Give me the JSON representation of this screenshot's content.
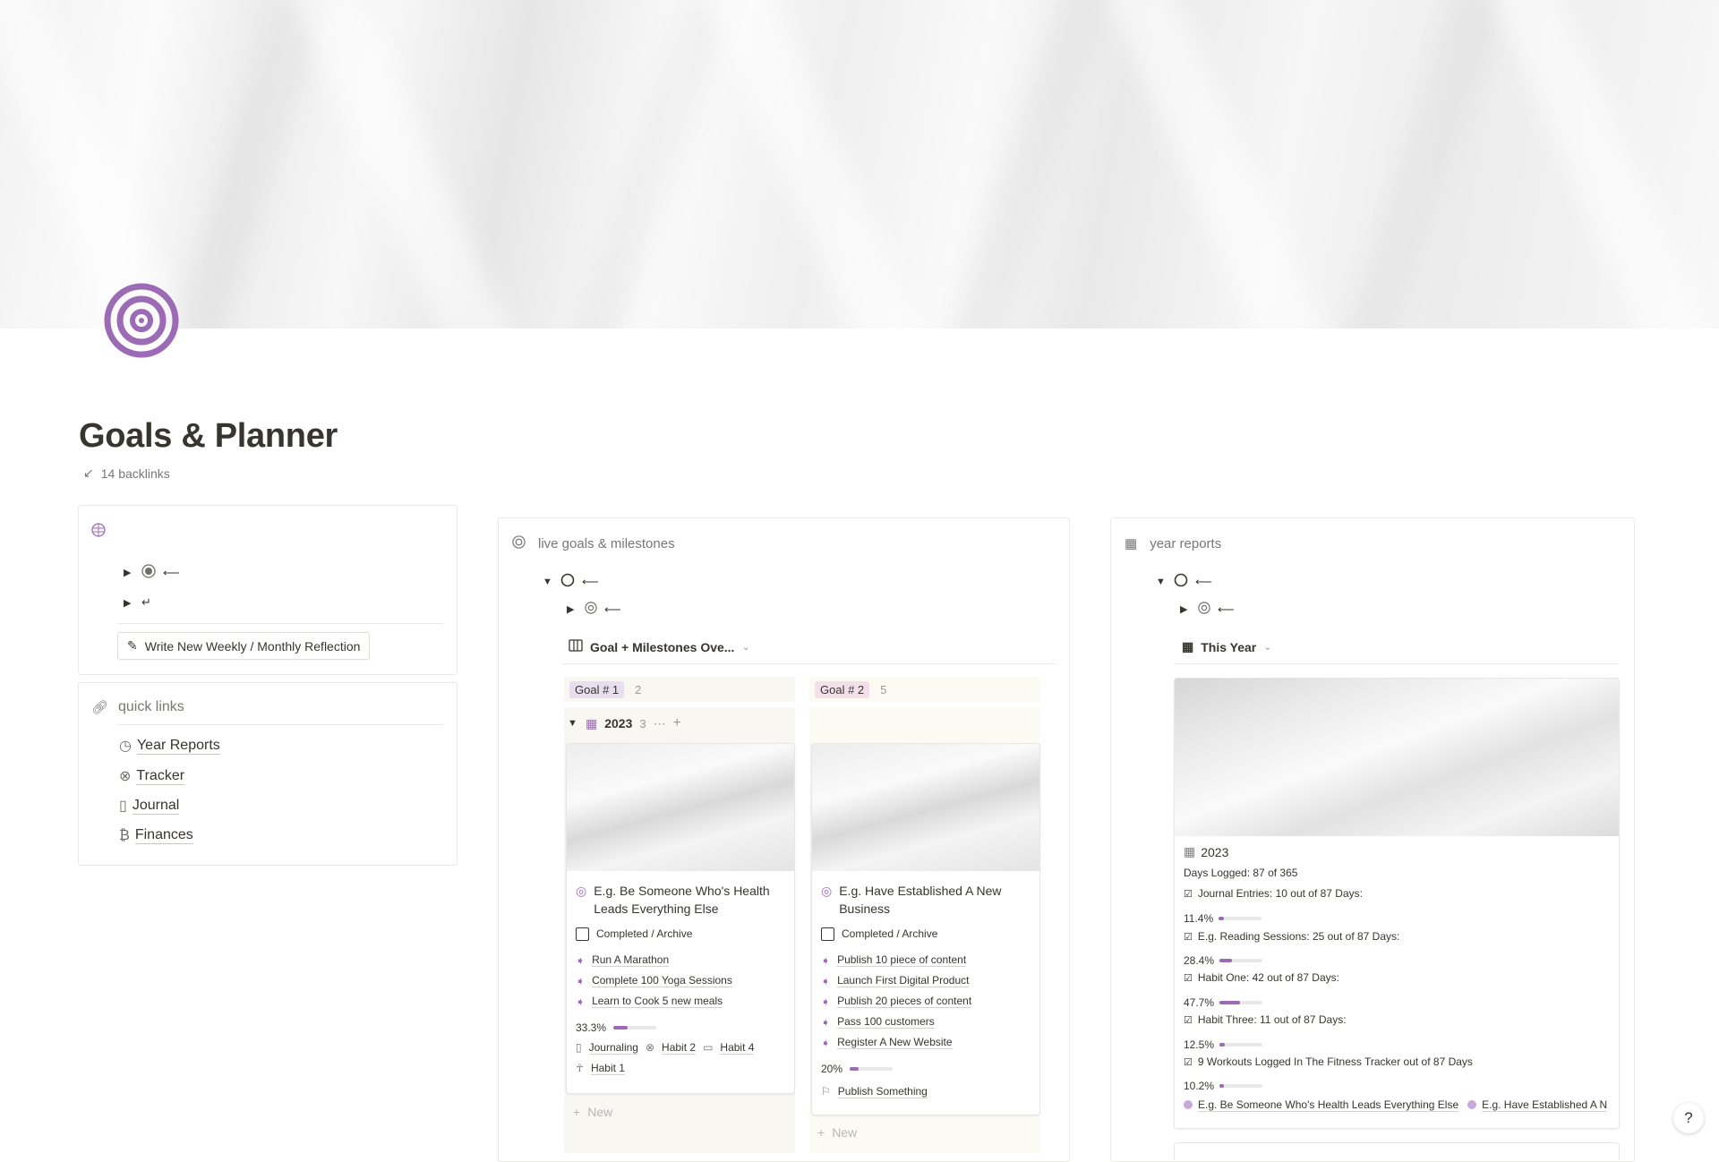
{
  "page": {
    "title": "Goals & Planner",
    "backlinks": "14 backlinks",
    "icon": "target-icon",
    "accent_color": "#9b6bb5"
  },
  "left_panel": {
    "toggle_1_marker": "⟵",
    "toggle_2_marker": "↵",
    "reflection_button": "Write New Weekly / Monthly Reflection"
  },
  "quick_links": {
    "heading": "quick links",
    "items": [
      {
        "label": "Year Reports",
        "icon": "clock-link-icon"
      },
      {
        "label": "Tracker",
        "icon": "x-circle-link-icon"
      },
      {
        "label": "Journal",
        "icon": "book-link-icon"
      },
      {
        "label": "Finances",
        "icon": "finance-link-icon"
      }
    ]
  },
  "goals_section": {
    "heading": "live goals & milestones",
    "toggle_marker": "⟵",
    "sub_toggle_marker": "⟵",
    "view_name": "Goal + Milestones Ove...",
    "groups": [
      {
        "label": "Goal # 1",
        "count": "2"
      },
      {
        "label": "Goal # 2",
        "count": "5"
      }
    ],
    "subgroup": {
      "label": "2023",
      "count": "3"
    },
    "new_label": "New",
    "cards": [
      {
        "title": "E.g. Be Someone Who's Health Leads Everything Else",
        "status": "Completed / Archive",
        "milestones": [
          "Run A Marathon",
          "Complete 100 Yoga Sessions",
          "Learn to Cook 5 new meals"
        ],
        "progress_label": "33.3%",
        "progress_value": 0.333,
        "habits": [
          "Journaling",
          "Habit 2",
          "Habit 4"
        ],
        "habit_extra": "Habit 1"
      },
      {
        "title": "E.g. Have Established A New Business",
        "status": "Completed / Archive",
        "milestones": [
          "Publish 10 piece of content",
          "Launch First Digital Product",
          "Publish 20 pieces of content",
          "Pass 100 customers",
          "Register A New Website"
        ],
        "progress_label": "20%",
        "progress_value": 0.2,
        "action": "Publish Something"
      }
    ]
  },
  "year_section": {
    "heading": "year reports",
    "toggle_marker": "⟵",
    "sub_toggle_marker": "⟵",
    "view_name": "This Year",
    "card": {
      "title": "2023",
      "days_logged": "Days Logged: 87 of 365",
      "stats": [
        {
          "label": "Journal Entries: 10 out of 87 Days:",
          "pct": "11.4%",
          "value": 0.114
        },
        {
          "label": "E.g. Reading Sessions: 25 out of 87 Days:",
          "pct": "28.4%",
          "value": 0.284
        },
        {
          "label": "Habit One: 42 out of 87 Days:",
          "pct": "47.7%",
          "value": 0.477
        },
        {
          "label": "Habit Three: 11 out of 87 Days:",
          "pct": "12.5%",
          "value": 0.125
        },
        {
          "label": "9 Workouts Logged In The Fitness Tracker out of 87 Days",
          "pct": "10.2%",
          "value": 0.102
        }
      ],
      "goal_links": [
        "E.g. Be Someone Who's Health Leads Everything Else",
        "E.g. Have Established A N"
      ]
    }
  },
  "help_button": "?"
}
